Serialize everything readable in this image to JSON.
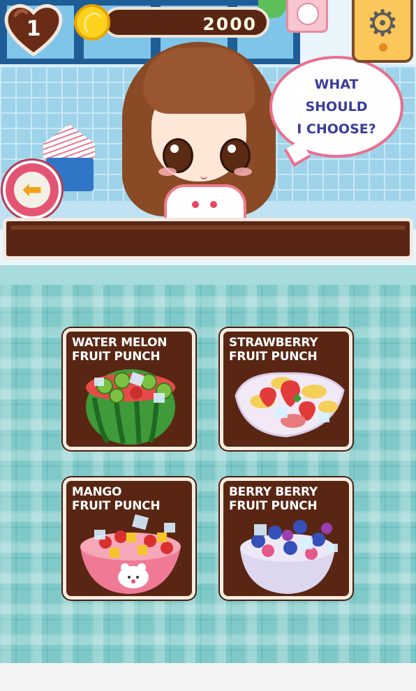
{
  "hud": {
    "lives": "1",
    "coins": "2000"
  },
  "speech": {
    "lines": [
      "WHAT",
      "SHOULD",
      "I CHOOSE?"
    ]
  },
  "menu": [
    {
      "title_line1": "WATER MELON",
      "title_line2": "FRUIT PUNCH",
      "dish": "watermelon-bowl"
    },
    {
      "title_line1": "STRAWBERRY",
      "title_line2": "FRUIT PUNCH",
      "dish": "white-plate"
    },
    {
      "title_line1": "MANGO",
      "title_line2": "FRUIT PUNCH",
      "dish": "pink-bear-bowl"
    },
    {
      "title_line1": "BERRY BERRY",
      "title_line2": "FRUIT PUNCH",
      "dish": "white-bowl"
    }
  ],
  "icons": {
    "lives": "heart-icon",
    "coins": "coin-icon",
    "settings": "gear-icon",
    "back": "back-arrow-icon"
  },
  "colors": {
    "brown": "#5a2614",
    "pink": "#e45573",
    "teal": "#7fcac9",
    "bubble_text": "#3a3d9a"
  }
}
